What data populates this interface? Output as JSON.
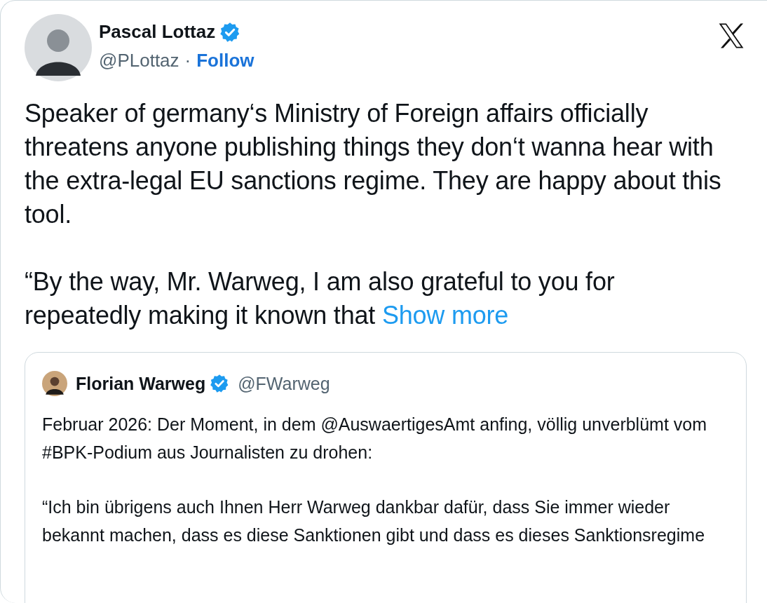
{
  "post": {
    "author": {
      "name": "Pascal Lottaz",
      "verified": true,
      "handle": "@PLottaz",
      "separator": "·",
      "follow": "Follow"
    },
    "paragraphs": [
      "Speaker of germany‘s Ministry of Foreign affairs officially threatens anyone publishing things they don‘t wanna hear with the extra-legal EU sanctions regime. They are happy about this tool.",
      "“By the way, Mr. Warweg, I am also grateful to you for repeatedly making it known that"
    ],
    "show_more": "Show more",
    "quoted": {
      "author": {
        "name": "Florian Warweg",
        "verified": true,
        "handle": "@FWarweg"
      },
      "paragraphs": [
        "Februar 2026: Der Moment, in dem @AuswaertigesAmt anfing, völlig unverblümt vom #BPK-Podium aus Journalisten zu drohen:",
        "“Ich bin übrigens auch Ihnen Herr Warweg dankbar dafür, dass Sie immer wieder bekannt machen, dass es diese Sanktionen gibt und dass es dieses Sanktionsregime"
      ]
    }
  }
}
